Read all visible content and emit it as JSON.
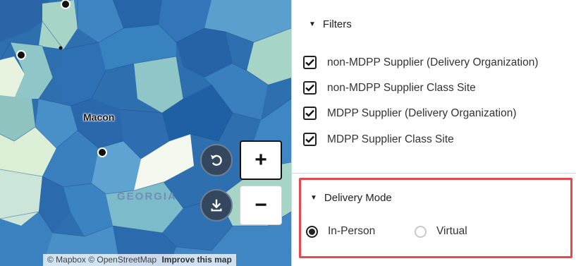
{
  "map": {
    "city_label": "Macon",
    "state_label": "GEORGIA",
    "attribution": "© Mapbox © OpenStreetMap",
    "improve_link": "Improve this map",
    "controls": {
      "reset_icon": "reset-icon",
      "download_icon": "download-icon",
      "zoom_in_label": "+",
      "zoom_out_label": "−"
    },
    "colors": {
      "dark": "#2166ac",
      "mid": "#3a82c0",
      "light": "#67a9cf",
      "pale": "#a6d5c8",
      "lightest": "#e7f2df"
    }
  },
  "filters": {
    "title": "Filters",
    "items": [
      {
        "label": "non-MDPP Supplier (Delivery Organization)",
        "checked": true
      },
      {
        "label": "non-MDPP Supplier Class Site",
        "checked": true
      },
      {
        "label": "MDPP Supplier (Delivery Organization)",
        "checked": true
      },
      {
        "label": "MDPP Supplier Class Site",
        "checked": true
      }
    ]
  },
  "delivery_mode": {
    "title": "Delivery Mode",
    "options": [
      {
        "label": "In-Person",
        "selected": true
      },
      {
        "label": "Virtual",
        "selected": false
      }
    ],
    "highlight_color": "#e5484d"
  }
}
